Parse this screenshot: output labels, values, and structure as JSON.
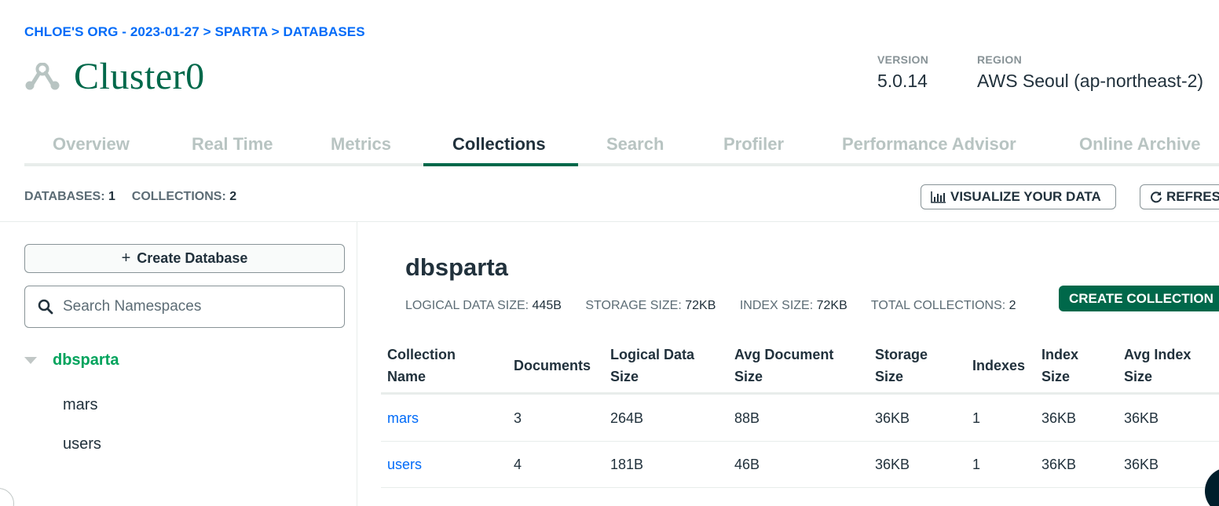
{
  "breadcrumb": "CHLOE'S ORG - 2023-01-27 > SPARTA > DATABASES",
  "cluster": {
    "name": "Cluster0"
  },
  "meta": {
    "version_label": "VERSION",
    "version_value": "5.0.14",
    "region_label": "REGION",
    "region_value": "AWS Seoul (ap-northeast-2)"
  },
  "tabs": [
    {
      "label": "Overview"
    },
    {
      "label": "Real Time"
    },
    {
      "label": "Metrics"
    },
    {
      "label": "Collections",
      "active": true
    },
    {
      "label": "Search"
    },
    {
      "label": "Profiler"
    },
    {
      "label": "Performance Advisor"
    },
    {
      "label": "Online Archive"
    }
  ],
  "counts": {
    "databases_label": "DATABASES:",
    "databases_value": "1",
    "collections_label": "COLLECTIONS:",
    "collections_value": "2"
  },
  "toolbar": {
    "visualize_label": "VISUALIZE YOUR DATA",
    "refresh_label": "REFRESH"
  },
  "sidebar": {
    "create_database_label": "Create Database",
    "search_placeholder": "Search Namespaces",
    "database": "dbsparta",
    "collections": [
      "mars",
      "users"
    ]
  },
  "main": {
    "db_title": "dbsparta",
    "stats": [
      {
        "label": "LOGICAL DATA SIZE:",
        "value": "445B"
      },
      {
        "label": "STORAGE SIZE:",
        "value": "72KB"
      },
      {
        "label": "INDEX SIZE:",
        "value": "72KB"
      },
      {
        "label": "TOTAL COLLECTIONS:",
        "value": "2"
      }
    ],
    "create_collection_label": "CREATE COLLECTION",
    "columns": [
      {
        "l1": "Collection",
        "l2": "Name"
      },
      {
        "l1": "Documents",
        "l2": ""
      },
      {
        "l1": "Logical Data",
        "l2": "Size"
      },
      {
        "l1": "Avg Document",
        "l2": "Size"
      },
      {
        "l1": "Storage",
        "l2": "Size"
      },
      {
        "l1": "Indexes",
        "l2": ""
      },
      {
        "l1": "Index",
        "l2": "Size"
      },
      {
        "l1": "Avg Index",
        "l2": "Size"
      }
    ],
    "rows": [
      [
        "mars",
        "3",
        "264B",
        "88B",
        "36KB",
        "1",
        "36KB",
        "36KB"
      ],
      [
        "users",
        "4",
        "181B",
        "46B",
        "36KB",
        "1",
        "36KB",
        "36KB"
      ]
    ]
  },
  "colors": {
    "accent_green": "#00684a",
    "link_blue": "#016bf8",
    "tree_green": "#00a35c"
  }
}
